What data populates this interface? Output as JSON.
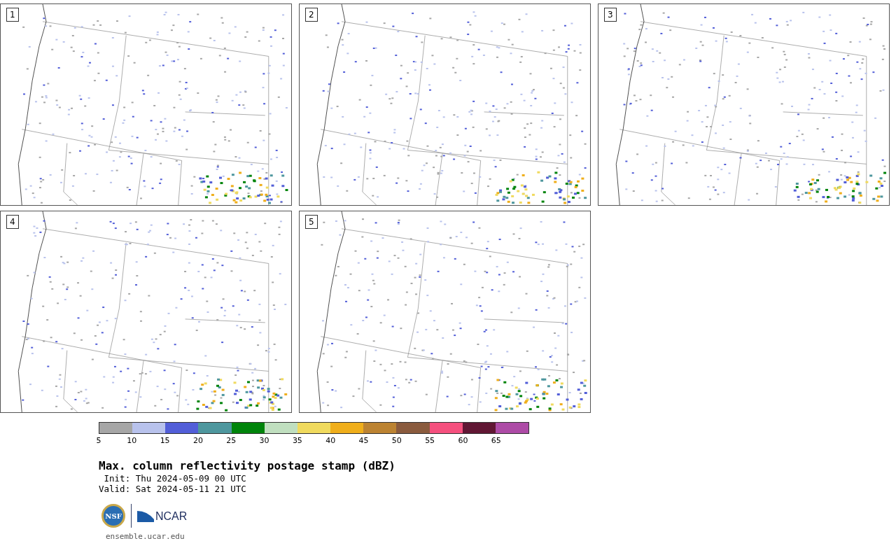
{
  "panels": [
    {
      "label": "1"
    },
    {
      "label": "2"
    },
    {
      "label": "3"
    },
    {
      "label": "4"
    },
    {
      "label": "5"
    }
  ],
  "colorbar": {
    "bins": [
      {
        "color": "#a6a6a6",
        "tick": "5"
      },
      {
        "color": "#b8c2ec",
        "tick": "10"
      },
      {
        "color": "#525ed8",
        "tick": "15"
      },
      {
        "color": "#4e979e",
        "tick": "20"
      },
      {
        "color": "#00840b",
        "tick": "25"
      },
      {
        "color": "#c0dfbf",
        "tick": "30"
      },
      {
        "color": "#f0da5e",
        "tick": "35"
      },
      {
        "color": "#efae1b",
        "tick": "40"
      },
      {
        "color": "#bc8332",
        "tick": "45"
      },
      {
        "color": "#8a5b3e",
        "tick": "50"
      },
      {
        "color": "#f5507e",
        "tick": "55"
      },
      {
        "color": "#611734",
        "tick": "60"
      },
      {
        "color": "#ad4ba6",
        "tick": "65"
      }
    ]
  },
  "title": "Max. column reflectivity postage stamp (dBZ)",
  "init": " Init: Thu 2024-05-09 00 UTC",
  "valid": "Valid: Sat 2024-05-11 21 UTC",
  "logos": {
    "nsf": "NSF",
    "ncar": "NCAR"
  },
  "url": "ensemble.ucar.edu"
}
